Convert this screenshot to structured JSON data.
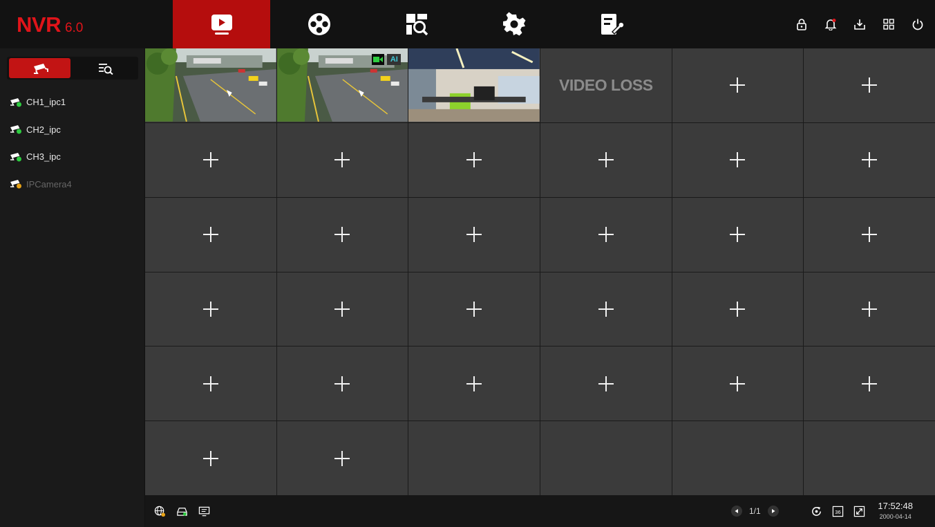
{
  "app": {
    "logo": "NVR",
    "version": "6.0"
  },
  "nav": {
    "items": [
      {
        "icon": "live-view-icon",
        "active": true
      },
      {
        "icon": "playback-icon",
        "active": false
      },
      {
        "icon": "search-icon",
        "active": false
      },
      {
        "icon": "settings-icon",
        "active": false
      },
      {
        "icon": "maintenance-icon",
        "active": false
      }
    ],
    "right_icons": [
      "lock-icon",
      "alarm-bell-icon",
      "download-icon",
      "layout-icon",
      "power-icon"
    ]
  },
  "sidebar": {
    "tabs": [
      {
        "icon": "camera-list-icon",
        "active": true
      },
      {
        "icon": "device-search-icon",
        "active": false
      }
    ],
    "cameras": [
      {
        "label": "CH1_ipc1",
        "status": "online"
      },
      {
        "label": "CH2_ipc",
        "status": "online"
      },
      {
        "label": "CH3_ipc",
        "status": "online"
      },
      {
        "label": "IPCamera4",
        "status": "offline"
      }
    ]
  },
  "grid": {
    "video_loss_text": "VIDEO LOSS",
    "ai_badge": "AI",
    "cells": [
      "feed-street",
      "feed-street-ai",
      "feed-office",
      "video-loss",
      "add",
      "add",
      "add",
      "add",
      "add",
      "add",
      "add",
      "add",
      "add",
      "add",
      "add",
      "add",
      "add",
      "add",
      "add",
      "add",
      "add",
      "add",
      "add",
      "add",
      "add",
      "add",
      "add",
      "add",
      "add",
      "add",
      "add",
      "add",
      "empty",
      "empty",
      "empty",
      "empty"
    ]
  },
  "bottombar": {
    "left_icons": [
      "network-icon",
      "hdd-icon",
      "display-icon"
    ],
    "page": "1/1",
    "right_icons": [
      "sequence-icon",
      "split-36-icon",
      "fullscreen-icon"
    ],
    "split_label": "36",
    "time": "17:52:48",
    "date": "2000-04-14"
  },
  "colors": {
    "accent": "#c21414",
    "logo": "#e0141a",
    "online": "#2ecc40",
    "offline": "#e8a317"
  }
}
